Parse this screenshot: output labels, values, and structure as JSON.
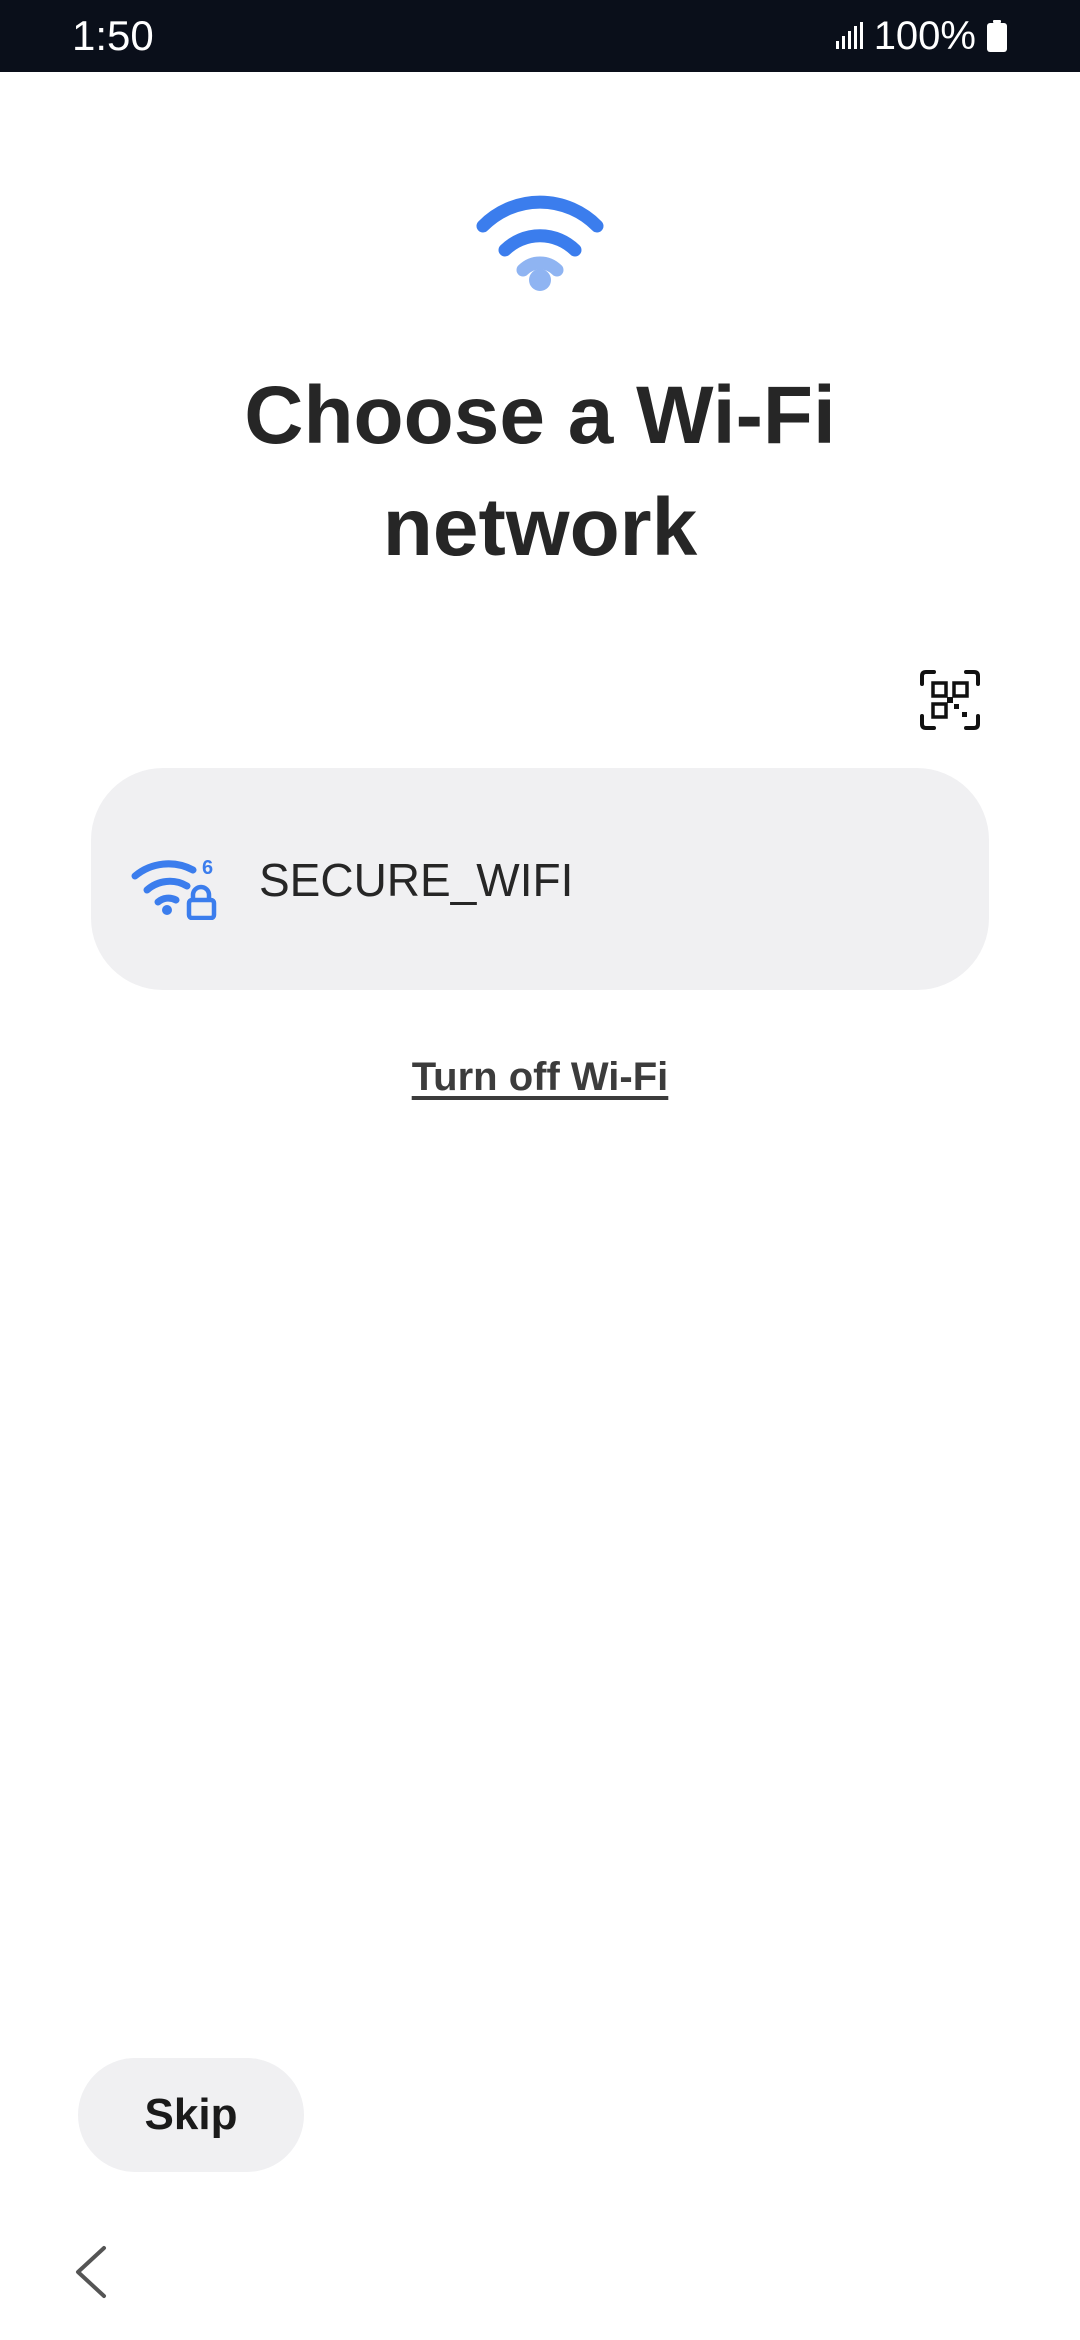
{
  "status_bar": {
    "time": "1:50",
    "battery": "100%",
    "icons": [
      "signal-icon",
      "battery-icon"
    ]
  },
  "header": {
    "icon": "wifi-icon",
    "title": "Choose a Wi-Fi network"
  },
  "qr_scan": {
    "icon": "qr-code-scan-icon"
  },
  "networks": [
    {
      "name": "SECURE_WIFI",
      "icon": "wifi6-secured-icon",
      "badge": "6"
    }
  ],
  "actions": {
    "turn_off_label": "Turn off Wi-Fi",
    "skip_label": "Skip"
  },
  "nav": {
    "back_icon": "chevron-left-icon"
  },
  "colors": {
    "accent": "#3b7ded",
    "accent_light": "#8fb4f2",
    "card_bg": "#f0f0f2",
    "status_bar_bg": "#0a0f1a",
    "text": "#262626"
  }
}
